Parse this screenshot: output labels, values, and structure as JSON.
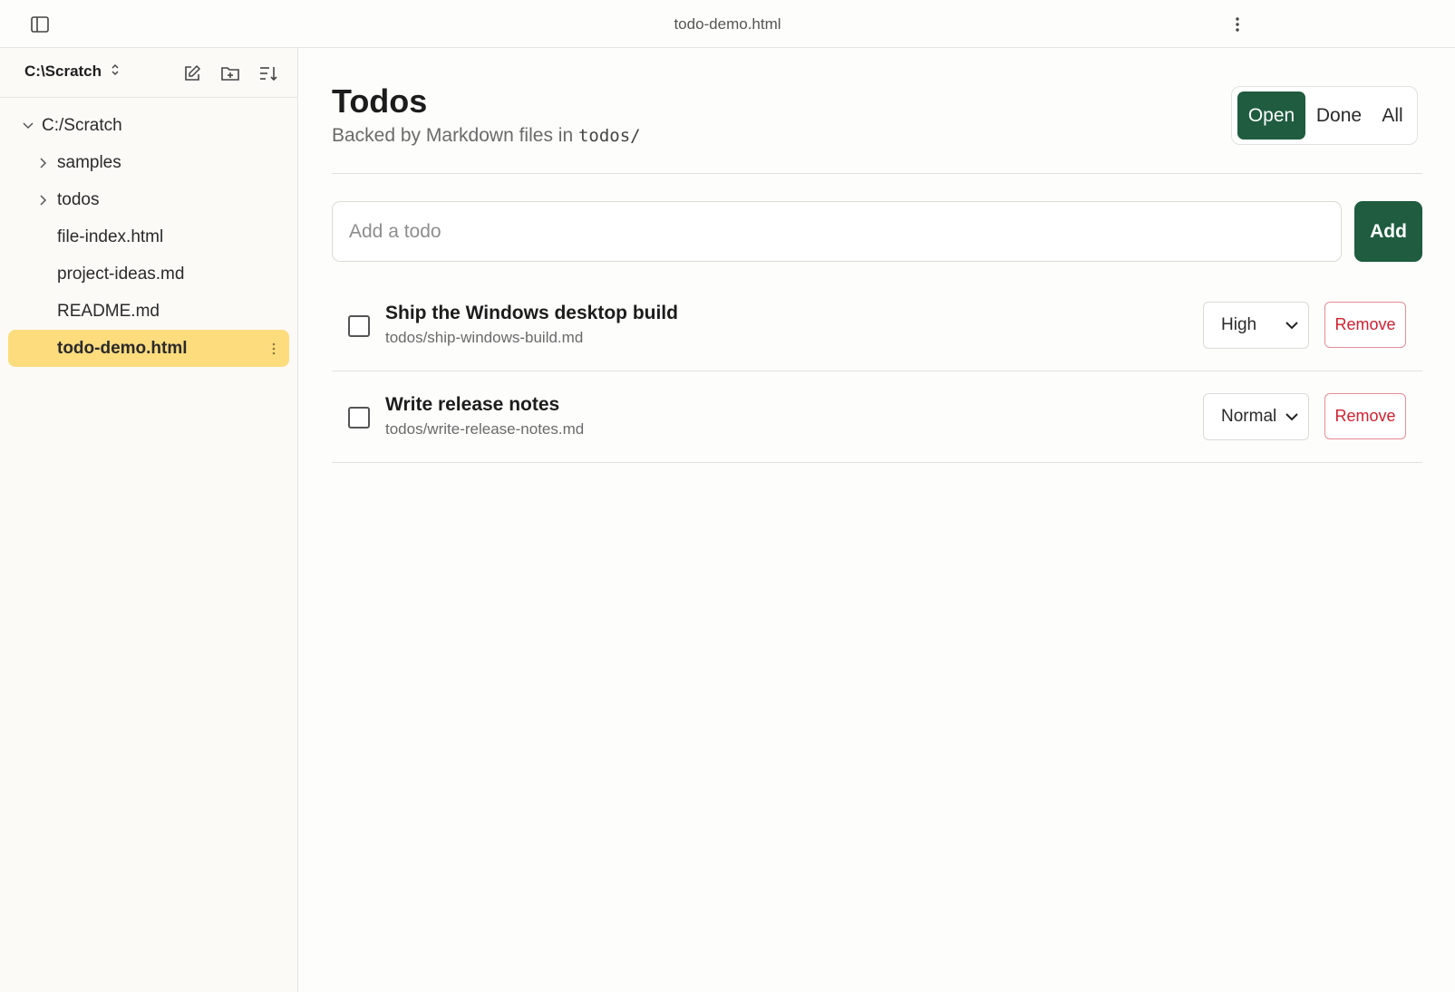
{
  "window": {
    "title": "todo-demo.html"
  },
  "sidebar": {
    "workspace": "C:\\Scratch",
    "tree": [
      {
        "label": "C:/Scratch",
        "type": "folder",
        "expanded": true
      },
      {
        "label": "samples",
        "type": "folder",
        "expanded": false
      },
      {
        "label": "todos",
        "type": "folder",
        "expanded": false
      },
      {
        "label": "file-index.html",
        "type": "file"
      },
      {
        "label": "project-ideas.md",
        "type": "file"
      },
      {
        "label": "README.md",
        "type": "file"
      },
      {
        "label": "todo-demo.html",
        "type": "file",
        "active": true
      }
    ]
  },
  "main": {
    "title": "Todos",
    "subtitle_prefix": "Backed by Markdown files in",
    "subtitle_code": "todos/",
    "filters": [
      "Open",
      "Done",
      "All"
    ],
    "selected_filter": "Open",
    "input_placeholder": "Add a todo",
    "add_label": "Add",
    "todos": [
      {
        "title": "Ship the Windows desktop build",
        "path": "todos/ship-windows-build.md",
        "priority": "High",
        "done": false,
        "remove_label": "Remove"
      },
      {
        "title": "Write release notes",
        "path": "todos/write-release-notes.md",
        "priority": "Normal",
        "done": false,
        "remove_label": "Remove"
      }
    ]
  },
  "icons": {
    "sidebar_toggle": "sidebar-toggle-icon",
    "more": "more-vertical-icon",
    "new_file": "new-file-icon",
    "new_folder": "new-folder-icon",
    "sort": "sort-icon",
    "workspace_switch": "chevron-updown-icon"
  },
  "colors": {
    "accent": "#1f5c40",
    "active_item": "#fddc7e",
    "danger": "#d0202f"
  }
}
